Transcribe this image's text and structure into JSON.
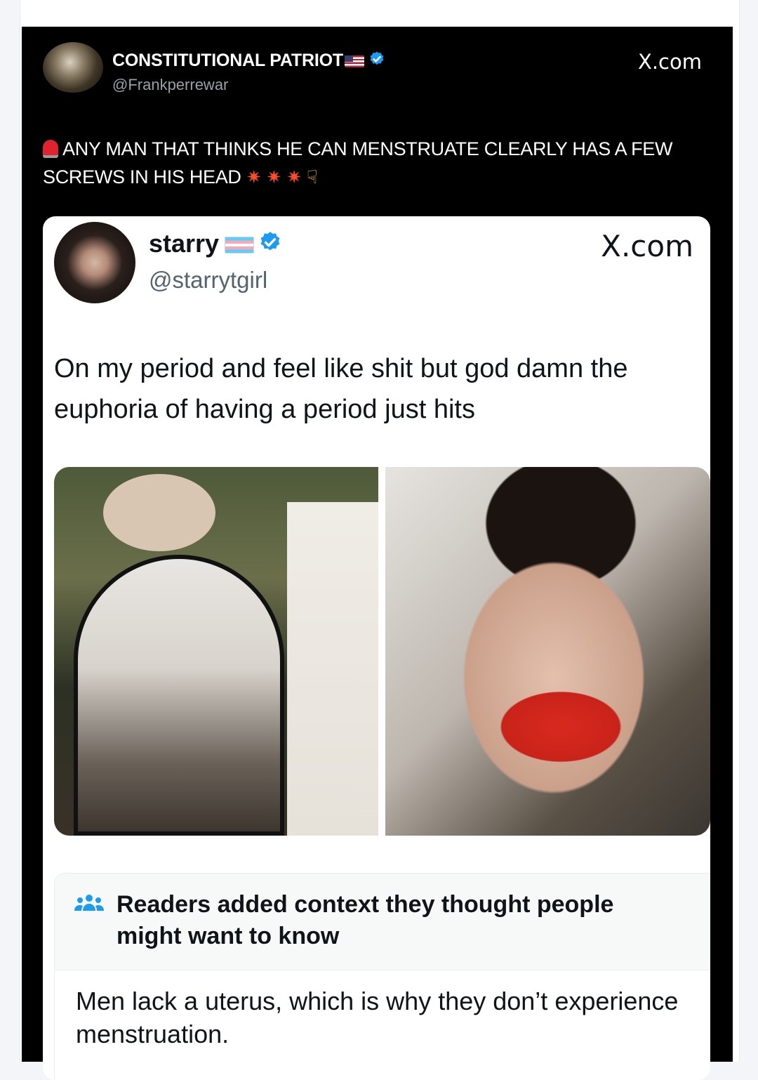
{
  "outer_post": {
    "display_name": "CONSTITUTIONAL PATRIOT",
    "handle": "@Frankperrewar",
    "source": "X.com",
    "text": "ANY MAN THAT THINKS HE CAN MENSTRUATE CLEARLY HAS A FEW SCREWS IN HIS HEAD",
    "emojis": [
      "siren",
      "collision",
      "collision",
      "collision",
      "pointing-down"
    ],
    "verified": true
  },
  "quoted_post": {
    "display_name": "starry",
    "handle": "@starrytgirl",
    "source": "X.com",
    "text": "On my period and feel like shit but god damn the euphoria of having a period just hits",
    "verified": true,
    "images": [
      "mirror-selfie-photo",
      "close-up-selfie-photo"
    ]
  },
  "community_note": {
    "title": "Readers added context they thought people might want to know",
    "body": "Men lack a uterus, which is why they don’t experience menstruation.",
    "icon": "people-icon"
  },
  "colors": {
    "outer_background": "#000000",
    "card_background": "#ffffff",
    "verified_blue": "#1d9bf0",
    "note_background": "#f7f9f9"
  }
}
